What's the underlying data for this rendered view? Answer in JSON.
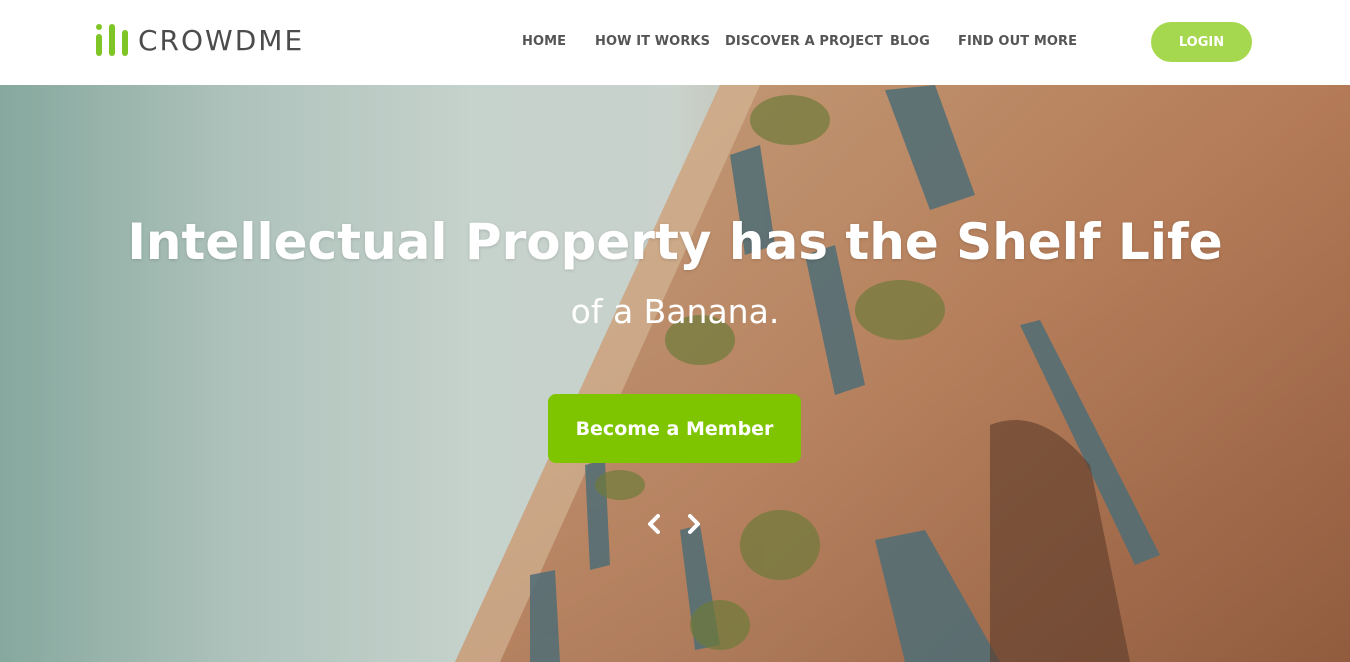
{
  "header": {
    "brand": "CROWDME",
    "nav": [
      {
        "label": "HOME"
      },
      {
        "label": "HOW IT WORKS"
      },
      {
        "label": "DISCOVER A PROJECT"
      },
      {
        "label": "BLOG"
      },
      {
        "label": "FIND OUT MORE"
      }
    ],
    "login_label": "LOGIN"
  },
  "hero": {
    "headline": "Intellectual Property has the Shelf Life",
    "subline": "of a Banana.",
    "cta_label": "Become a Member",
    "prev_icon": "chevron-left-icon",
    "next_icon": "chevron-right-icon"
  },
  "colors": {
    "accent": "#7ec500",
    "login_bg": "#a6d84f",
    "nav_text": "#555555"
  }
}
